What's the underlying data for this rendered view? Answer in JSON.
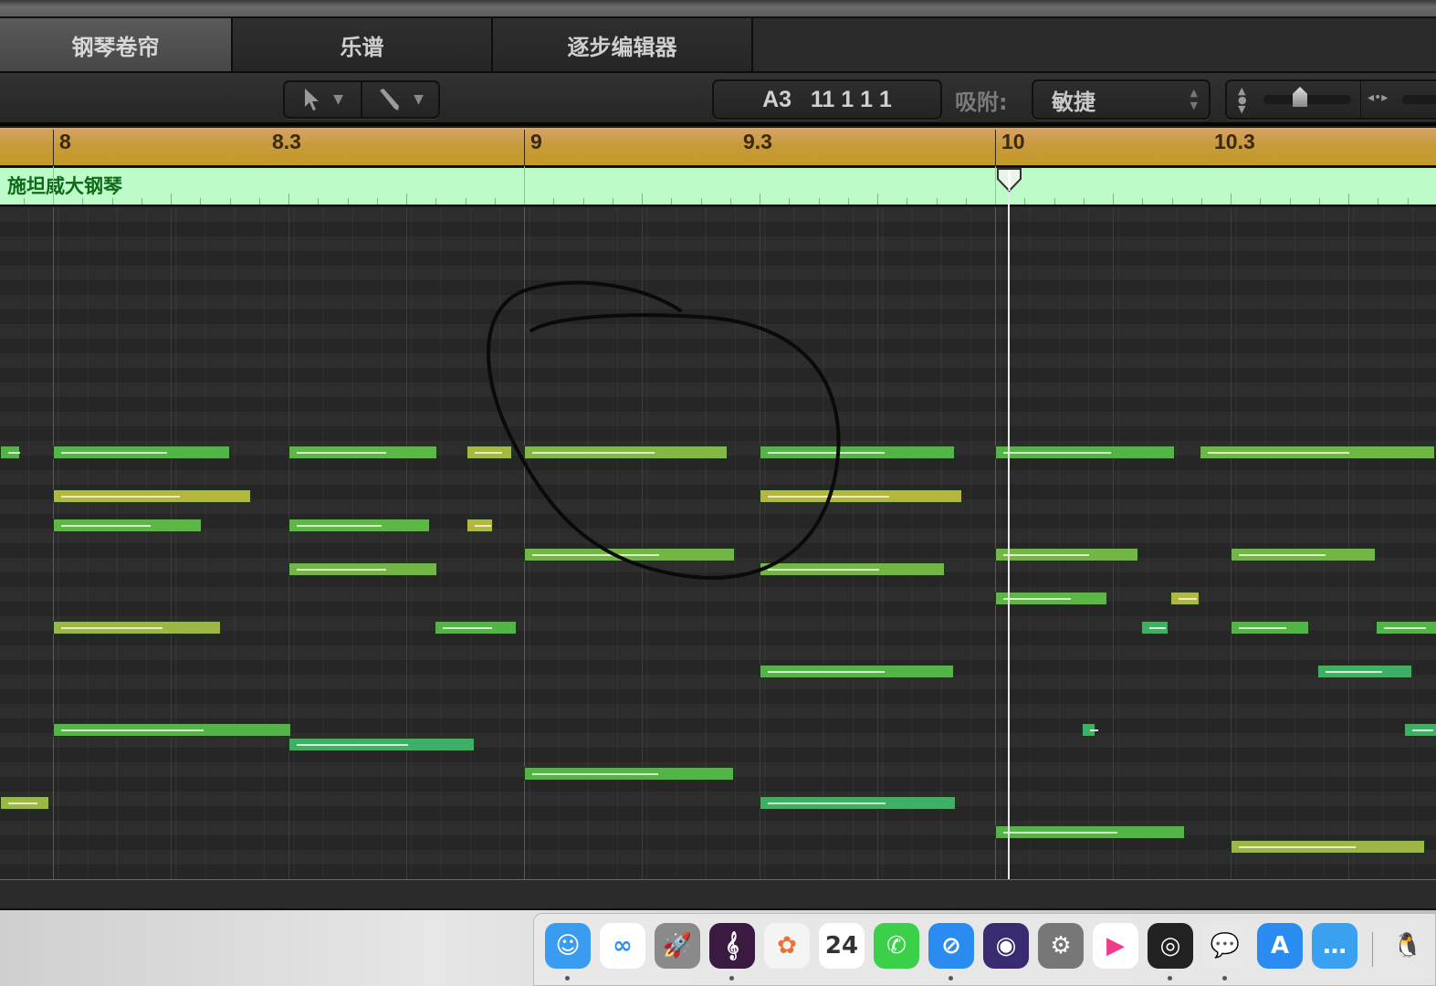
{
  "tabs": [
    {
      "label": "钢琴卷帘",
      "active": true
    },
    {
      "label": "乐谱"
    },
    {
      "label": "逐步编辑器"
    }
  ],
  "toolbar": {
    "pointer_tool": "pointer-tool",
    "pencil_tool": "pencil-tool",
    "position_display": "A3   11 1 1 1",
    "snap_label": "吸附:",
    "snap_value": "敏捷"
  },
  "ruler": {
    "labels": [
      {
        "text": "8",
        "bar": 8
      },
      {
        "text": "8.3",
        "bar": 8.5
      },
      {
        "text": "9",
        "bar": 9
      },
      {
        "text": "9.3",
        "bar": 9.5
      },
      {
        "text": "10",
        "bar": 10
      },
      {
        "text": "10.3",
        "bar": 10.5
      }
    ]
  },
  "track": {
    "name": "施坦威大钢琴"
  },
  "playhead_bar": 10.03,
  "notes": [
    {
      "start": -0.45,
      "len": 0.17,
      "row": 8,
      "color": "#52b548"
    },
    {
      "start": 0,
      "len": 1.5,
      "row": 8,
      "color": "#52b548"
    },
    {
      "start": 2,
      "len": 1.26,
      "row": 8,
      "color": "#5cb846"
    },
    {
      "start": 3.51,
      "len": 0.39,
      "row": 8,
      "color": "#a8b83e"
    },
    {
      "start": 4,
      "len": 1.73,
      "row": 8,
      "color": "#84b844"
    },
    {
      "start": 6,
      "len": 1.66,
      "row": 8,
      "color": "#52b548"
    },
    {
      "start": 8,
      "len": 1.53,
      "row": 8,
      "color": "#52b548"
    },
    {
      "start": 9.74,
      "len": 2,
      "row": 8,
      "color": "#6cb844"
    },
    {
      "start": 0,
      "len": 1.68,
      "row": 11,
      "color": "#b4b640"
    },
    {
      "start": 6,
      "len": 1.72,
      "row": 11,
      "color": "#b4b640"
    },
    {
      "start": 0,
      "len": 1.26,
      "row": 13,
      "color": "#5cb846"
    },
    {
      "start": 2,
      "len": 1.2,
      "row": 13,
      "color": "#5cb846"
    },
    {
      "start": 3.51,
      "len": 0.23,
      "row": 13,
      "color": "#b4b640"
    },
    {
      "start": 4,
      "len": 1.79,
      "row": 15,
      "color": "#72b644"
    },
    {
      "start": 8,
      "len": 1.22,
      "row": 15,
      "color": "#72b644"
    },
    {
      "start": 10,
      "len": 1.23,
      "row": 15,
      "color": "#72b644"
    },
    {
      "start": 2,
      "len": 1.26,
      "row": 16,
      "color": "#72b644"
    },
    {
      "start": 6,
      "len": 1.57,
      "row": 16,
      "color": "#72b644"
    },
    {
      "start": 8,
      "len": 0.95,
      "row": 18,
      "color": "#5cb846"
    },
    {
      "start": 9.49,
      "len": 0.25,
      "row": 18,
      "color": "#b4b640"
    },
    {
      "start": 0,
      "len": 1.43,
      "row": 20,
      "color": "#9cb842"
    },
    {
      "start": 3.24,
      "len": 0.7,
      "row": 20,
      "color": "#52b548"
    },
    {
      "start": 9.24,
      "len": 0.23,
      "row": 20,
      "color": "#3eaf66"
    },
    {
      "start": 10,
      "len": 0.67,
      "row": 20,
      "color": "#52b548"
    },
    {
      "start": 11.23,
      "len": 0.6,
      "row": 20,
      "color": "#52b548"
    },
    {
      "start": 6,
      "len": 1.65,
      "row": 23,
      "color": "#52b548"
    },
    {
      "start": 10.74,
      "len": 0.8,
      "row": 23,
      "color": "#3eaf66"
    },
    {
      "start": 8.74,
      "len": 0.11,
      "row": 27,
      "color": "#3eaf66"
    },
    {
      "start": 11.47,
      "len": 0.3,
      "row": 27,
      "color": "#3eaf66"
    },
    {
      "start": 0,
      "len": 2.02,
      "row": 27,
      "color": "#52b548"
    },
    {
      "start": 2,
      "len": 1.58,
      "row": 28,
      "color": "#3eaf66"
    },
    {
      "start": 4,
      "len": 1.78,
      "row": 30,
      "color": "#52b548"
    },
    {
      "start": -0.45,
      "len": 0.42,
      "row": 32,
      "color": "#9cb842"
    },
    {
      "start": 6,
      "len": 1.67,
      "row": 32,
      "color": "#3eaf66"
    },
    {
      "start": 8,
      "len": 1.61,
      "row": 34,
      "color": "#52b548"
    },
    {
      "start": 10,
      "len": 1.65,
      "row": 35,
      "color": "#9cb842"
    }
  ],
  "dock": [
    {
      "name": "finder",
      "glyph": "☺",
      "bg": "#3a9cf0",
      "dot": true
    },
    {
      "name": "baidu-netdisk",
      "glyph": "∞",
      "bg": "#ffffff",
      "fg": "#2f8ef0"
    },
    {
      "name": "launchpad",
      "glyph": "🚀",
      "bg": "#8a8a8a"
    },
    {
      "name": "logic-pro",
      "glyph": "𝄞",
      "bg": "#3a1a40",
      "dot": true
    },
    {
      "name": "photos",
      "glyph": "✿",
      "bg": "#f4f4f4",
      "fg": "#e8733a"
    },
    {
      "name": "calendar",
      "glyph": "24",
      "bg": "#ffffff",
      "fg": "#333"
    },
    {
      "name": "facetime",
      "glyph": "✆",
      "bg": "#3ccf4a"
    },
    {
      "name": "safari",
      "glyph": "⊘",
      "bg": "#2a8cf0",
      "dot": true
    },
    {
      "name": "siri",
      "glyph": "◉",
      "bg": "#3a2a70"
    },
    {
      "name": "system-preferences",
      "glyph": "⚙",
      "bg": "#777"
    },
    {
      "name": "youku",
      "glyph": "▶",
      "bg": "#ffffff",
      "fg": "#f03a8a"
    },
    {
      "name": "logic-remote",
      "glyph": "◎",
      "bg": "#222",
      "dot": true
    },
    {
      "name": "wechat",
      "glyph": "💬",
      "bg": "#e8e8e8",
      "fg": "#5ac840",
      "dot": true
    },
    {
      "name": "app-store",
      "glyph": "A",
      "bg": "#2a8cf0"
    },
    {
      "name": "messages",
      "glyph": "…",
      "bg": "#3aa0f0"
    },
    {
      "name": "qq",
      "glyph": "🐧",
      "bg": "transparent",
      "fg": "#000"
    }
  ]
}
